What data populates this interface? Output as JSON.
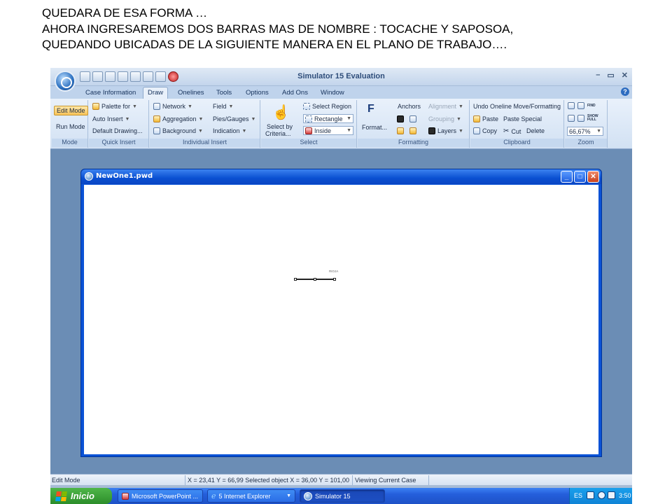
{
  "slide": {
    "line1": "QUEDARA DE ESA FORMA …",
    "line2": "AHORA INGRESAREMOS  DOS BARRAS MAS DE NOMBRE : TOCACHE Y SAPOSOA,",
    "line3": "QUEDANDO  UBICADAS DE LA SIGUIENTE MANERA EN EL PLANO DE TRABAJO…."
  },
  "app": {
    "title": "Simulator 15 Evaluation",
    "tabs": [
      "Case Information",
      "Draw",
      "Onelines",
      "Tools",
      "Options",
      "Add Ons",
      "Window"
    ],
    "active_tab": "Draw"
  },
  "ribbon": {
    "mode": {
      "edit": "Edit Mode",
      "run": "Run Mode",
      "label": "Mode"
    },
    "quick_insert": {
      "palette": "Palette for",
      "auto": "Auto Insert",
      "default": "Default Drawing...",
      "label": "Quick Insert"
    },
    "individual_insert": {
      "network": "Network",
      "aggregation": "Aggregation",
      "background": "Background",
      "field": "Field",
      "pies": "Pies/Gauges",
      "indication": "Indication",
      "label": "Individual Insert"
    },
    "select": {
      "by_criteria_1": "Select by",
      "by_criteria_2": "Criteria...",
      "region": "Select Region",
      "shape": "Rectangle",
      "inside": "Inside",
      "label": "Select"
    },
    "formatting": {
      "format": "Format...",
      "anchors": "Anchors",
      "alignment": "Alignment",
      "grouping": "Grouping",
      "layers": "Layers",
      "label": "Formatting"
    },
    "clipboard": {
      "undo": "Undo Oneline Move/Formatting",
      "paste": "Paste",
      "paste_special": "Paste Special",
      "copy": "Copy",
      "cut": "Cut",
      "delete": "Delete",
      "label": "Clipboard"
    },
    "zoom": {
      "find": "FIND",
      "show_full": "SHOW FULL",
      "level": "66,67%",
      "label": "Zoom"
    }
  },
  "document": {
    "title": "NewOne1.pwd",
    "bus_label": "RIOJA"
  },
  "status": {
    "mode": "Edit Mode",
    "coords": "X = 23,41 Y = 66,99 Selected object X = 36,00 Y = 101,00",
    "view": "Viewing Current Case"
  },
  "taskbar": {
    "start": "Inicio",
    "tasks": [
      "Microsoft PowerPoint ...",
      "5 Internet Explorer",
      "Simulator 15"
    ],
    "lang": "ES",
    "clock": "3:50"
  }
}
